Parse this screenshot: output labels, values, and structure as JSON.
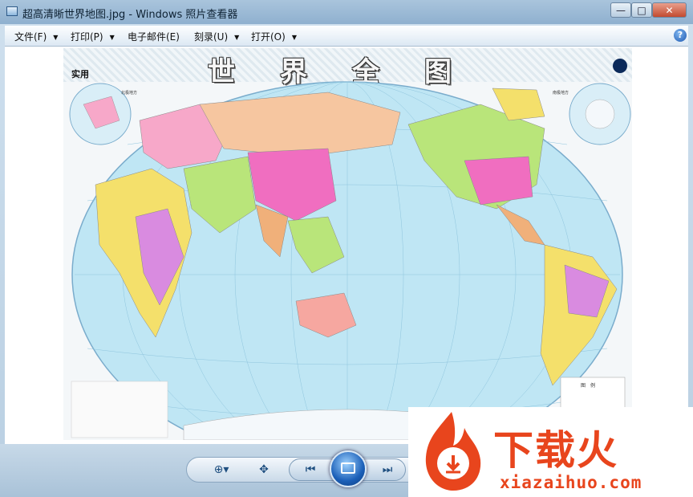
{
  "window": {
    "title": "超高清晰世界地图.jpg - Windows 照片查看器",
    "min_glyph": "—",
    "max_glyph": "□",
    "close_glyph": "✕"
  },
  "menu": {
    "items": [
      {
        "label": "文件(F)"
      },
      {
        "label": "打印(P)"
      },
      {
        "label": "电子邮件(E)"
      },
      {
        "label": "刻录(U)"
      },
      {
        "label": "打开(O)"
      }
    ],
    "arrow_glyph": "▼",
    "help_glyph": "?"
  },
  "image": {
    "title": "世界全图",
    "subtitle": "实用",
    "inset_left_label": "北极地方",
    "inset_right_label": "南极地方",
    "legend_title": "图　例",
    "ocean_color": "#bfe6f4",
    "land_colors": [
      "#f7a8c9",
      "#f4e06b",
      "#b9e57a",
      "#f0b07a",
      "#d98be0",
      "#9fcff7",
      "#f6c6a0"
    ]
  },
  "controls": {
    "zoom_glyph": "⊕▾",
    "actual_size_glyph": "✥",
    "prev_glyph": "⏮",
    "next_glyph": "⏭"
  },
  "watermark": {
    "text": "下载火",
    "url": "xiazaihuo.com",
    "color": "#e8451d"
  }
}
